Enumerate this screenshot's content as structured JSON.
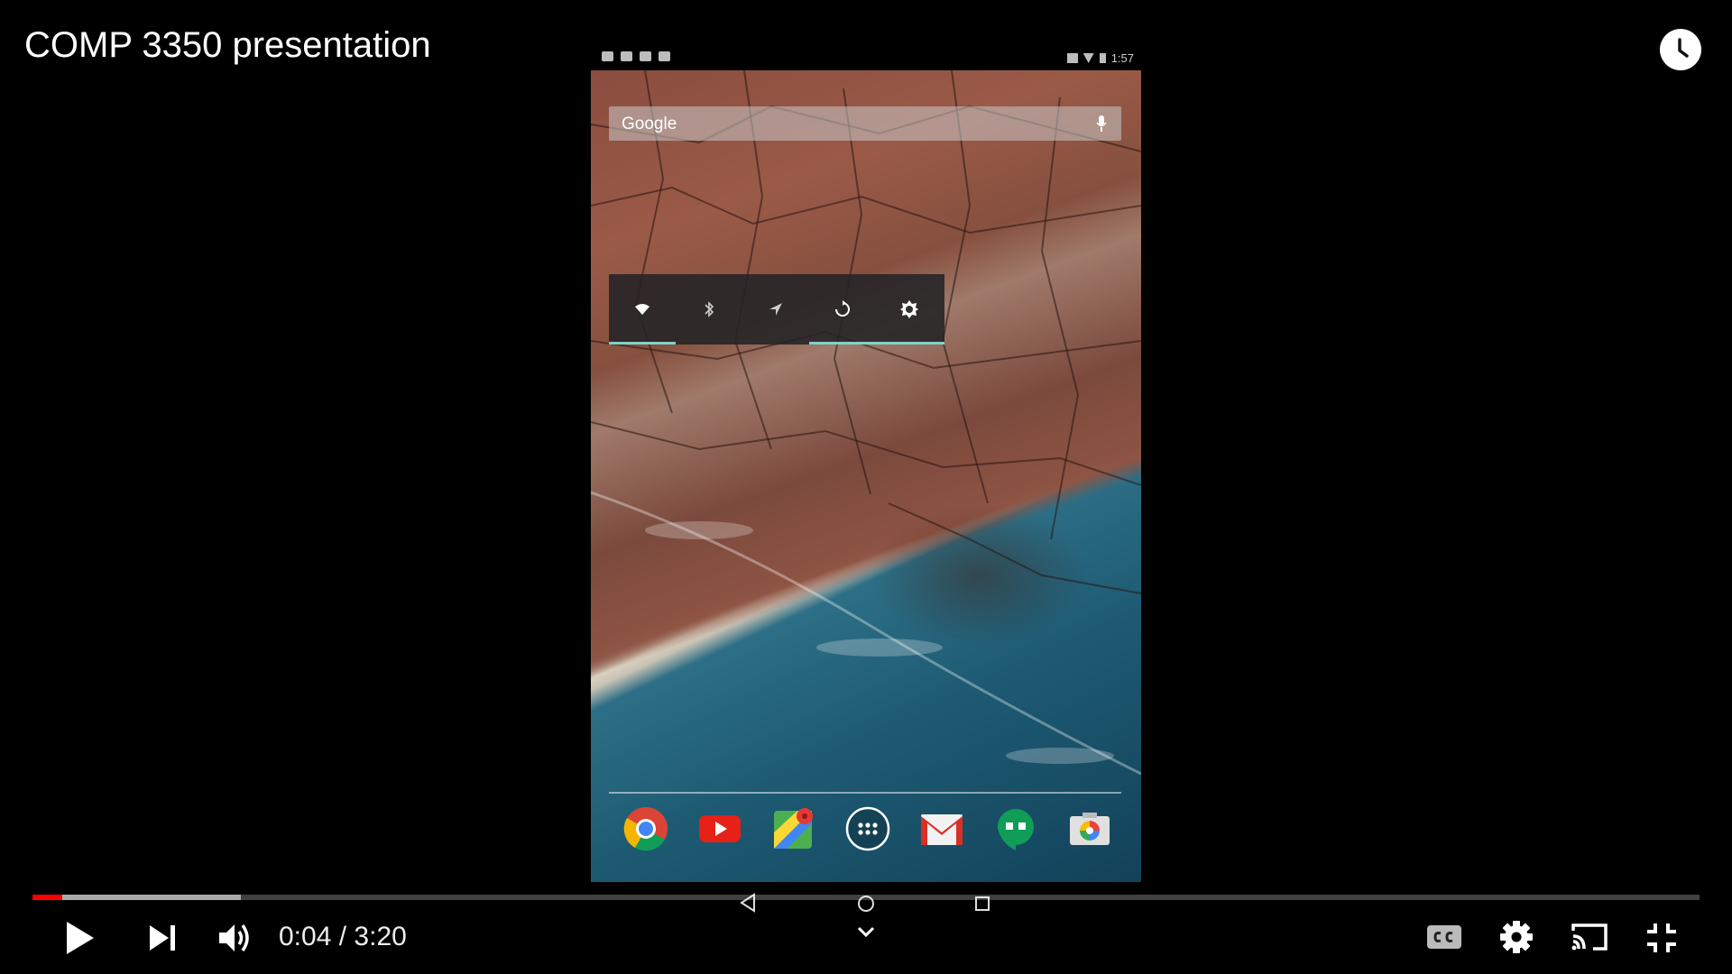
{
  "video": {
    "title": "COMP 3350 presentation"
  },
  "phone": {
    "status_time": "1:57",
    "search_label": "Google",
    "power_widget": [
      "wifi",
      "bluetooth",
      "location",
      "sync",
      "brightness"
    ],
    "dock_apps": [
      "chrome",
      "youtube",
      "maps",
      "app-drawer",
      "gmail",
      "hangouts",
      "photos"
    ]
  },
  "player": {
    "time_current": "0:04",
    "time_separator": "/",
    "time_total": "3:20",
    "progress_played": 0.018,
    "progress_loaded": 0.125,
    "controls_left": [
      "play-icon",
      "next-icon",
      "volume-icon"
    ],
    "controls_right": [
      "captions-icon",
      "settings-icon",
      "cast-icon",
      "exit-fullscreen-icon"
    ]
  },
  "colors": {
    "progress_played": "#ff0000",
    "background": "#000000"
  }
}
